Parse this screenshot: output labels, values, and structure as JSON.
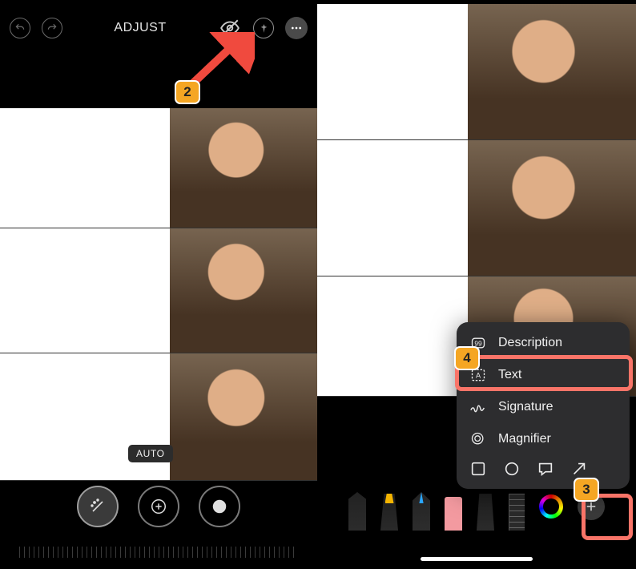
{
  "leftPanel": {
    "title": "ADJUST",
    "autoLabel": "AUTO",
    "steps": {
      "step2": "2"
    }
  },
  "rightPanel": {
    "menu": {
      "items": [
        {
          "label": "Description"
        },
        {
          "label": "Text"
        },
        {
          "label": "Signature"
        },
        {
          "label": "Magnifier"
        }
      ]
    },
    "steps": {
      "step3": "3",
      "step4": "4"
    }
  }
}
